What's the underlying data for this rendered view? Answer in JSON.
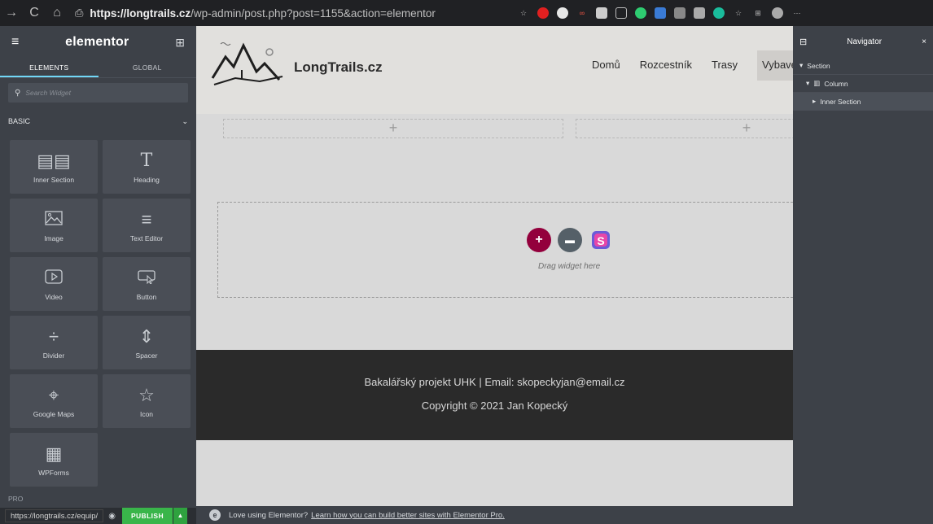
{
  "browser": {
    "back_icon": "→",
    "refresh_icon": "C",
    "home_icon": "⌂",
    "lock_icon": "⎙",
    "url_host": "https://longtrails.cz",
    "url_path": "/wp-admin/post.php?post=1155&action=elementor"
  },
  "panel": {
    "brand": "elementor",
    "tabs": [
      "ELEMENTS",
      "GLOBAL"
    ],
    "search_placeholder": "Search Widget",
    "category": "BASIC",
    "widgets": [
      {
        "label": "Inner Section",
        "icon": "▤▤"
      },
      {
        "label": "Heading",
        "icon": "T"
      },
      {
        "label": "Image",
        "icon": "🖾"
      },
      {
        "label": "Text Editor",
        "icon": "≡"
      },
      {
        "label": "Video",
        "icon": "▷"
      },
      {
        "label": "Button",
        "icon": "☐"
      },
      {
        "label": "Divider",
        "icon": "÷"
      },
      {
        "label": "Spacer",
        "icon": "⇕"
      },
      {
        "label": "Google Maps",
        "icon": "⌖"
      },
      {
        "label": "Icon",
        "icon": "☆"
      },
      {
        "label": "WPForms",
        "icon": "▦"
      }
    ],
    "pro_label": "PRO",
    "status_url": "https://longtrails.cz/equip/",
    "publish_label": "PUBLISH"
  },
  "canvas": {
    "site_title": "LongTrails.cz",
    "menu": [
      "Domů",
      "Rozcestník",
      "Trasy",
      "Vybaver"
    ],
    "drag_text": "Drag widget here",
    "footer_line1": "Bakalářský projekt UHK | Email: skopeckyjan@email.cz",
    "footer_line2": "Copyright © 2021 Jan Kopecký",
    "promo_text": "Love using Elementor?",
    "promo_link": "Learn how you can build better sites with Elementor Pro."
  },
  "navigator": {
    "title": "Navigator",
    "items": [
      "Section",
      "Column",
      "Inner Section"
    ]
  },
  "colors": {
    "panel_bg": "#3d4148",
    "accent_tab": "#71d7f7",
    "publish": "#39b54a",
    "add_btn": "#93003c",
    "folder_btn": "#556068"
  }
}
